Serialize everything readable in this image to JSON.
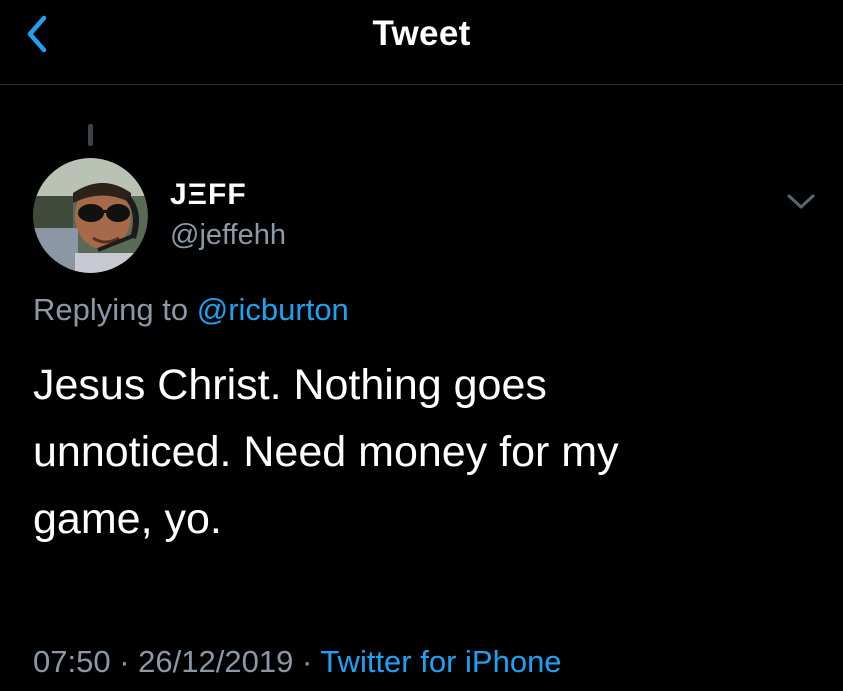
{
  "nav": {
    "title": "Tweet",
    "back_icon": "chevron-left-icon"
  },
  "tweet": {
    "author": {
      "name": "JΞFF",
      "handle": "@jeffehh",
      "avatar": "profile-photo"
    },
    "more_icon": "chevron-down-icon",
    "reply": {
      "prefix": "Replying to",
      "handle": "@ricburton"
    },
    "text": "Jesus Christ. Nothing goes unnoticed. Need money for my game, yo.",
    "time": "07:50",
    "date": "26/12/2019",
    "separator": "·",
    "source": "Twitter for iPhone"
  },
  "colors": {
    "background": "#000000",
    "text_primary": "#ffffff",
    "text_secondary": "#8b98a5",
    "accent": "#1da1f2",
    "divider": "#2a2e33"
  }
}
